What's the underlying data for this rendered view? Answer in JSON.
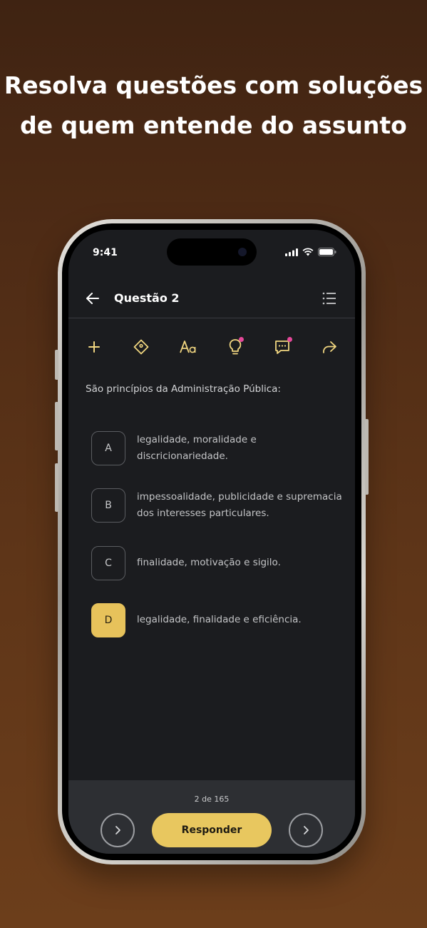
{
  "headline": {
    "line1": "Resolva questões com soluções",
    "line2": "de quem entende do assunto"
  },
  "status": {
    "time": "9:41"
  },
  "appbar": {
    "title": "Questão 2",
    "back_icon": "arrow-left-icon",
    "menu_icon": "list-icon"
  },
  "toolbar": {
    "icons": [
      "plus-icon",
      "tag-icon",
      "font-size-icon",
      "lightbulb-icon",
      "comment-icon",
      "share-icon"
    ]
  },
  "question": {
    "prompt": "São princípios da Administração Pública:"
  },
  "options": [
    {
      "letter": "A",
      "text": "legalidade, moralidade e discricionariedade."
    },
    {
      "letter": "B",
      "text": "impessoalidade, publicidade e supremacia dos interesses particulares."
    },
    {
      "letter": "C",
      "text": "finalidade, motivação e sigilo."
    },
    {
      "letter": "D",
      "text": "legalidade, finalidade e eficiência.",
      "selected": true
    }
  ],
  "footer": {
    "counter": "2 de 165",
    "answer_label": "Responder"
  },
  "colors": {
    "accent": "#e8c75f",
    "screen_bg": "#1b1c1f",
    "notification_dot": "#e5489a"
  }
}
